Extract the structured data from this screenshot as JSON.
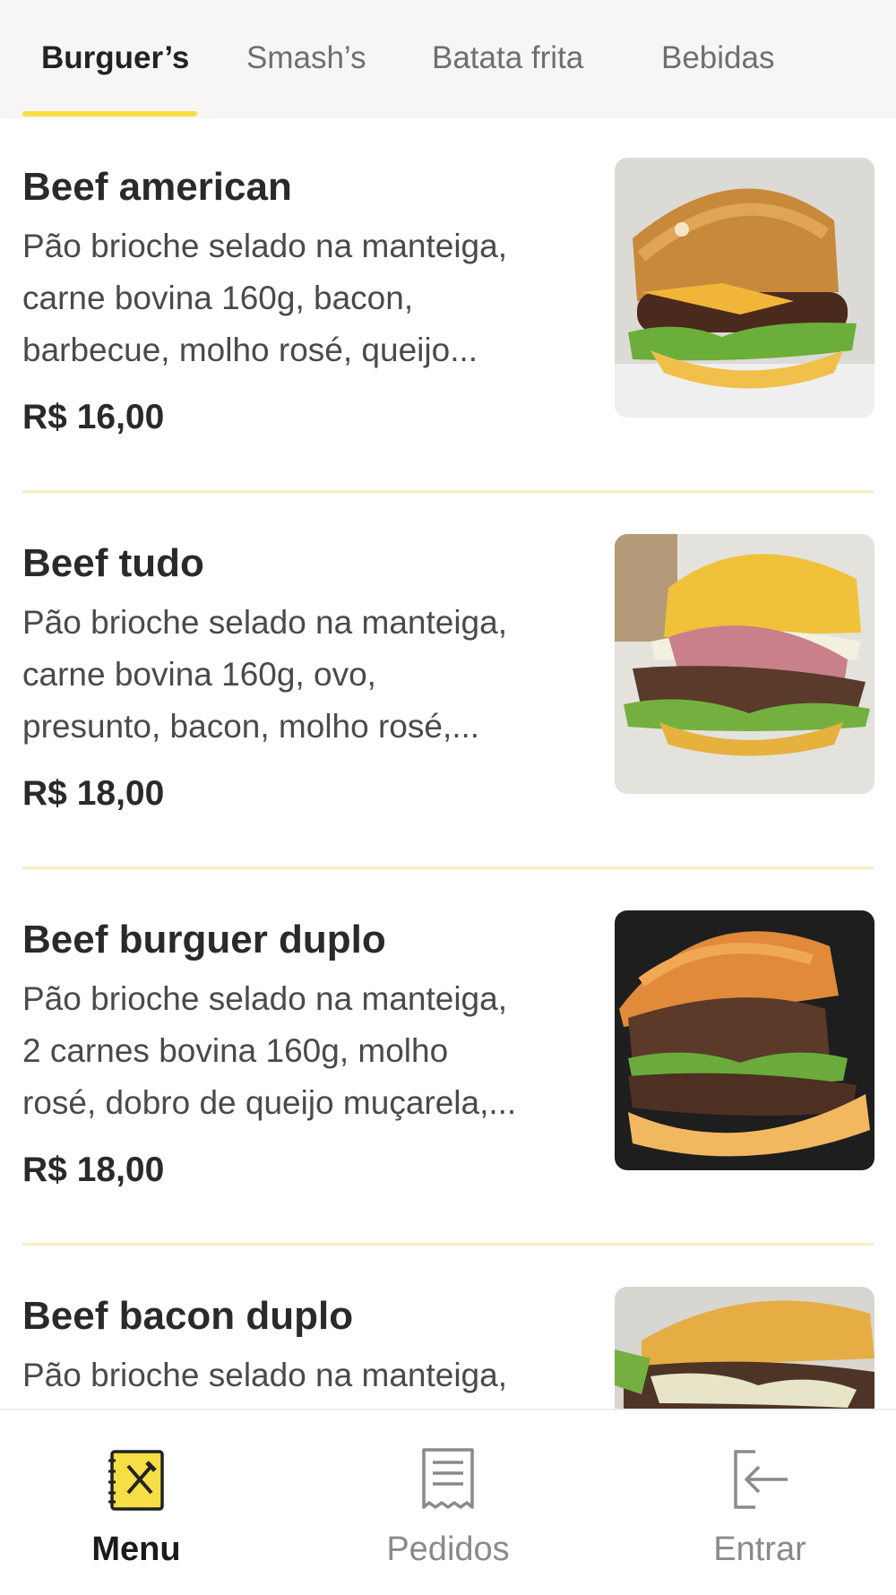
{
  "tabs": [
    {
      "label": "Burguer’s",
      "active": true
    },
    {
      "label": "Smash’s",
      "active": false
    },
    {
      "label": "Batata frita",
      "active": false
    },
    {
      "label": "Bebidas",
      "active": false
    }
  ],
  "products": [
    {
      "name": "Beef american",
      "description_lines": [
        "Pão brioche selado na manteiga,",
        "carne bovina 160g, bacon,",
        "barbecue, molho rosé, queijo..."
      ],
      "price": "R$ 16,00"
    },
    {
      "name": "Beef tudo",
      "description_lines": [
        "Pão brioche selado na manteiga,",
        "carne bovina 160g, ovo,",
        "presunto, bacon, molho rosé,..."
      ],
      "price": "R$ 18,00"
    },
    {
      "name": "Beef burguer duplo",
      "description_lines": [
        "Pão brioche selado na manteiga,",
        "2 carnes bovina 160g, molho",
        "rosé, dobro de queijo muçarela,..."
      ],
      "price": "R$ 18,00"
    },
    {
      "name": "Beef bacon duplo",
      "description_lines": [
        "Pão brioche selado na manteiga,"
      ],
      "price": ""
    }
  ],
  "bottom_nav": [
    {
      "label": "Menu",
      "icon": "menu-book-icon",
      "active": true
    },
    {
      "label": "Pedidos",
      "icon": "receipt-icon",
      "active": false
    },
    {
      "label": "Entrar",
      "icon": "login-icon",
      "active": false
    }
  ],
  "colors": {
    "accent": "#f6de45",
    "divider": "#f8eebc",
    "tab_bar_bg": "#f7f6f4"
  }
}
